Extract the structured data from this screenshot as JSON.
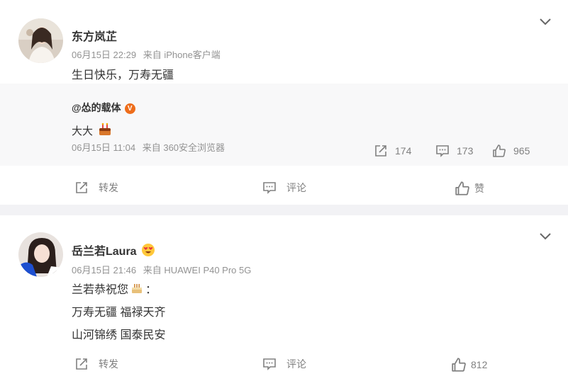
{
  "posts": [
    {
      "author": "东方岚芷",
      "time": "06月15日 22:29",
      "source": "来自 iPhone客户端",
      "text": "生日快乐，万寿无疆",
      "repost": {
        "author": "@怂的载体",
        "verified_badge": "V",
        "text": "大大",
        "emoji": "cake-icon",
        "time": "06月15日 11:04",
        "source": "来自 360安全浏览器",
        "stats": {
          "forward": "174",
          "comment": "173",
          "like": "965"
        }
      },
      "actions": {
        "forward": "转发",
        "comment": "评论",
        "like": "赞"
      }
    },
    {
      "author": "岳兰若Laura",
      "author_emoji": "love-face-icon",
      "time": "06月15日 21:46",
      "source": "来自 HUAWEI P40 Pro 5G",
      "lines": [
        "兰若恭祝您",
        "：",
        "万寿无疆 福禄天齐",
        "山河锦绣 国泰民安"
      ],
      "actions": {
        "forward": "转发",
        "comment": "评论",
        "like": "812"
      }
    }
  ],
  "colors": {
    "page_bg": "#f2f2f5",
    "card_bg": "#ffffff",
    "repost_bg": "#f8f8f9",
    "muted": "#939393",
    "icon": "#808080",
    "verified": "#ee6d1b"
  }
}
